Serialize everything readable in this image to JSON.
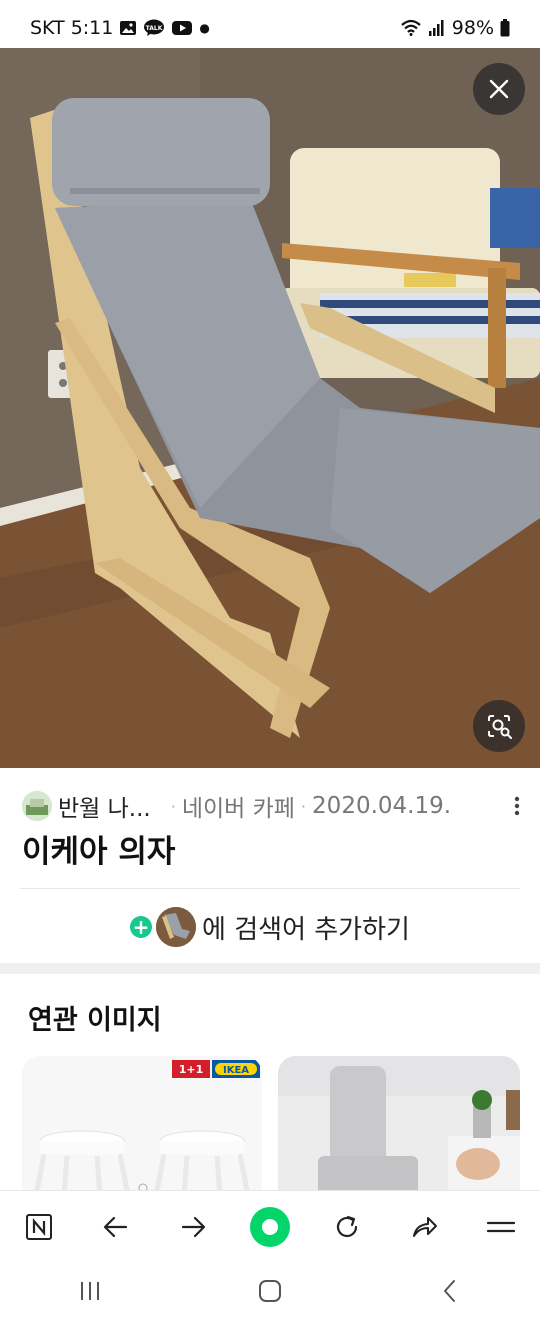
{
  "status_bar": {
    "carrier_time": "SKT 5:11",
    "battery": "98%"
  },
  "post": {
    "source_name": "반월 나...",
    "source_site": "네이버 카페",
    "date": "2020.04.19.",
    "title": "이케아 의자"
  },
  "add_search": {
    "label": "에 검색어 추가하기"
  },
  "related": {
    "heading": "연관 이미지",
    "card1_badge_deal": "1+1",
    "card1_badge_brand": "IKEA"
  },
  "colors": {
    "accent_green": "#03d56a",
    "plus_green": "#17c98a"
  },
  "icons": {
    "toolbar": [
      "naver-n-icon",
      "back-arrow-icon",
      "forward-arrow-icon",
      "home-green-icon",
      "refresh-icon",
      "share-icon",
      "menu-icon"
    ],
    "nav": [
      "recent-apps-icon",
      "home-nav-icon",
      "back-nav-icon"
    ]
  }
}
